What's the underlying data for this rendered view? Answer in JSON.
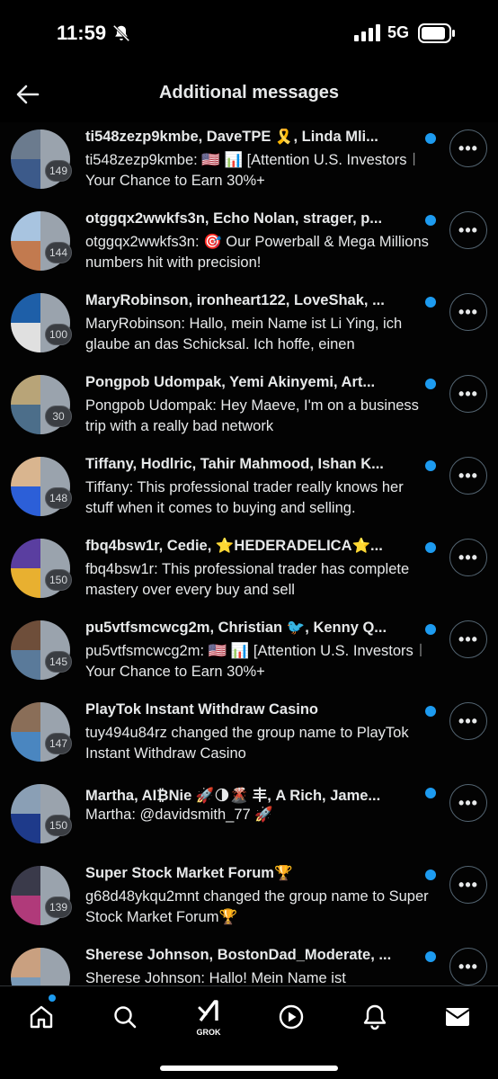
{
  "status": {
    "time": "11:59",
    "network": "5G",
    "icons": [
      "bell-off-icon",
      "signal-icon",
      "battery-icon"
    ]
  },
  "header": {
    "title": "Additional messages",
    "back_icon": "arrow-left-icon"
  },
  "conversations": [
    {
      "name": "ti548zezp9kmbe, DaveTPE 🎗️, Linda Mli...",
      "preview": "ti548zezp9kmbe: 🇺🇸 📊 [Attention U.S. Investors︱Your Chance to Earn 30%+",
      "count": "149",
      "unread": true,
      "colors": [
        "#6b7b8e",
        "#3c5a8a"
      ]
    },
    {
      "name": "otggqx2wwkfs3n, Echo Nolan, strager, p...",
      "preview": "otggqx2wwkfs3n: 🎯 Our Powerball & Mega Millions numbers hit with precision!",
      "count": "144",
      "unread": true,
      "colors": [
        "#a8c4e0",
        "#c27a4f"
      ]
    },
    {
      "name": "MaryRobinson, ironheart122, LoveShak, ...",
      "preview": "MaryRobinson: Hallo, mein Name ist Li Ying, ich glaube an das Schicksal. Ich hoffe, einen",
      "count": "100",
      "unread": true,
      "colors": [
        "#1e5fa8",
        "#e0e0e0"
      ]
    },
    {
      "name": "Pongpob Udompak, Yemi  Akinyemi, Art...",
      "preview": "Pongpob Udompak: Hey Maeve, I'm on a business trip with a really bad network",
      "count": "30",
      "unread": true,
      "colors": [
        "#b8a478",
        "#4c6e8a"
      ]
    },
    {
      "name": "Tiffany, Hodlric, Tahir Mahmood, Ishan K...",
      "preview": "Tiffany: This professional trader really knows her stuff when it comes to buying and selling.",
      "count": "148",
      "unread": true,
      "colors": [
        "#d9b58f",
        "#2c5fd8"
      ]
    },
    {
      "name": "fbq4bsw1r, Cedie, ⭐HEDERADELICA⭐...",
      "preview": "fbq4bsw1r: This professional trader has complete mastery over every buy and sell",
      "count": "150",
      "unread": true,
      "colors": [
        "#5a3ea0",
        "#e8b030"
      ]
    },
    {
      "name": "pu5vtfsmcwcg2m, Christian 🐦, Kenny Q...",
      "preview": "pu5vtfsmcwcg2m: 🇺🇸 📊 [Attention U.S. Investors︱Your Chance to Earn 30%+",
      "count": "145",
      "unread": true,
      "colors": [
        "#6e4e3a",
        "#5a7a9a"
      ]
    },
    {
      "name": "PlayTok Instant Withdraw Casino",
      "preview": "tuy494u84rz changed the group name to PlayTok Instant Withdraw Casino",
      "count": "147",
      "unread": true,
      "colors": [
        "#8a6e58",
        "#4a86c0"
      ]
    },
    {
      "name": "Martha, AI₿Nie 🚀🌗🌋 丰, A Rich, Jame...",
      "preview": "Martha: @davidsmith_77 🚀",
      "count": "150",
      "unread": true,
      "colors": [
        "#8a9fb5",
        "#1e3a8a"
      ]
    },
    {
      "name": "Super Stock Market Forum🏆",
      "preview": "g68d48ykqu2mnt changed the group name to Super Stock Market Forum🏆",
      "count": "139",
      "unread": true,
      "colors": [
        "#3a3a4a",
        "#b03a7a"
      ]
    },
    {
      "name": "Sherese Johnson, BostonDad_Moderate, ...",
      "preview": "Sherese Johnson: Hallo! Mein Name ist",
      "count": "",
      "unread": true,
      "colors": [
        "#c9a080",
        "#7a9ab8"
      ]
    }
  ],
  "more_icon": "more-horizontal-icon",
  "tabs": [
    {
      "name": "home",
      "icon": "home-icon",
      "label": ""
    },
    {
      "name": "search",
      "icon": "search-icon",
      "label": ""
    },
    {
      "name": "grok",
      "icon": "grok-icon",
      "label": "GROK"
    },
    {
      "name": "video",
      "icon": "play-icon",
      "label": ""
    },
    {
      "name": "notifications",
      "icon": "bell-icon",
      "label": ""
    },
    {
      "name": "messages",
      "icon": "mail-icon",
      "label": ""
    }
  ],
  "accent_color": "#1d9bf0"
}
